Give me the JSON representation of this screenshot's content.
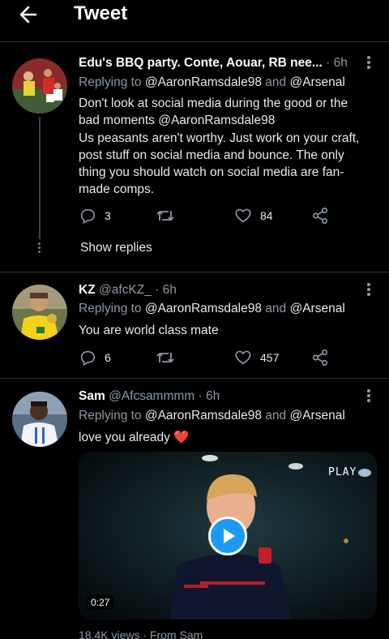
{
  "header": {
    "title": "Tweet",
    "back_icon": "arrow-left-icon"
  },
  "tweets": [
    {
      "name": "Edu's BBQ party. Conte, Aouar, RB nee...",
      "handle": "",
      "time": "· 6h",
      "replying_prefix": "Replying to",
      "replying_to_1": "@AaronRamsdale98",
      "replying_and": "and",
      "replying_to_2": "@Arsenal",
      "text": "Don't look at social media during the good or the bad moments @AaronRamsdale98\nUs peasants aren't worthy. Just work on your craft, post stuff on social media and bounce. The only thing you should watch on social media are fan-made comps.",
      "reply_count": "3",
      "retweet_count": "",
      "like_count": "84",
      "show_replies": "Show replies"
    },
    {
      "name": "KZ",
      "handle": "@afcKZ_",
      "time": "· 6h",
      "replying_prefix": "Replying to",
      "replying_to_1": "@AaronRamsdale98",
      "replying_and": "and",
      "replying_to_2": "@Arsenal",
      "text": "You are world class mate",
      "reply_count": "6",
      "retweet_count": "",
      "like_count": "457"
    },
    {
      "name": "Sam",
      "handle": "@Afcsammmm",
      "time": "· 6h",
      "replying_prefix": "Replying to",
      "replying_to_1": "@AaronRamsdale98",
      "replying_and": "and",
      "replying_to_2": "@Arsenal",
      "text": "love you already ❤️",
      "media": {
        "duration": "0:27",
        "overlay_text": "PLAY"
      },
      "views": "18.4K views · From Sam"
    }
  ],
  "colors": {
    "accent": "#1d9bf0",
    "background": "#000000",
    "muted": "#8b98a5",
    "divider": "#2f3336",
    "heart": "#f91880"
  }
}
